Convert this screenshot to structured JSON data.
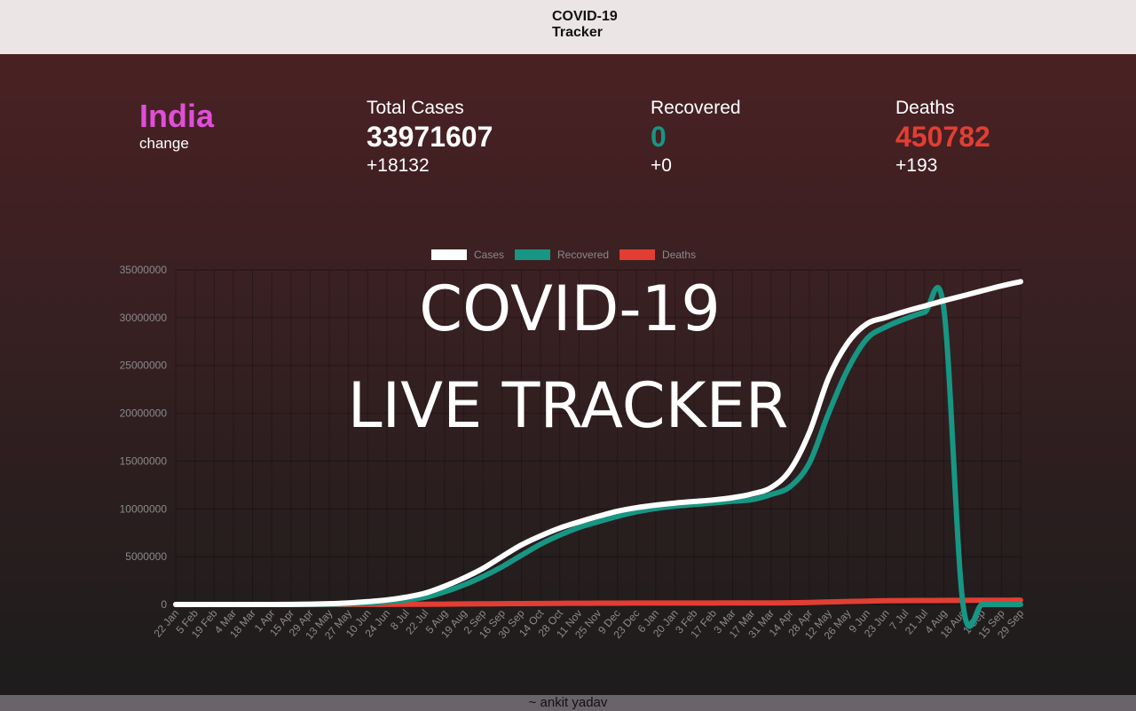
{
  "header": {
    "title_line1": "COVID-19",
    "title_line2": "Tracker"
  },
  "country": {
    "name": "India",
    "change_label": "change"
  },
  "stats": {
    "total": {
      "label": "Total Cases",
      "value": "33971607",
      "delta": "+18132",
      "color": "#ffffff"
    },
    "recovered": {
      "label": "Recovered",
      "value": "0",
      "delta": "+0",
      "color": "#179683"
    },
    "deaths": {
      "label": "Deaths",
      "value": "450782",
      "delta": "+193",
      "color": "#e23e33"
    }
  },
  "overlay": {
    "line1": "COVID-19",
    "line2": "LIVE TRACKER"
  },
  "footer": {
    "credit": "~ ankit yadav"
  },
  "chart_data": {
    "type": "line",
    "ylim": [
      0,
      35000000
    ],
    "yticks": [
      "0",
      "5000000",
      "10000000",
      "15000000",
      "20000000",
      "25000000",
      "30000000",
      "35000000"
    ],
    "categories": [
      "22 Jan",
      "5 Feb",
      "19 Feb",
      "4 Mar",
      "18 Mar",
      "1 Apr",
      "15 Apr",
      "29 Apr",
      "13 May",
      "27 May",
      "10 Jun",
      "24 Jun",
      "8 Jul",
      "22 Jul",
      "5 Aug",
      "19 Aug",
      "2 Sep",
      "16 Sep",
      "30 Sep",
      "14 Oct",
      "28 Oct",
      "11 Nov",
      "25 Nov",
      "9 Dec",
      "23 Dec",
      "6 Jan",
      "20 Jan",
      "3 Feb",
      "17 Feb",
      "3 Mar",
      "17 Mar",
      "31 Mar",
      "14 Apr",
      "28 Apr",
      "12 May",
      "26 May",
      "9 Jun",
      "23 Jun",
      "7 Jul",
      "21 Jul",
      "4 Aug",
      "18 Aug",
      "1 Sep",
      "15 Sep",
      "29 Sep"
    ],
    "legend_position": "top",
    "grid": true,
    "series": [
      {
        "name": "Cases",
        "color": "#ffffff",
        "values": [
          0,
          0,
          0,
          0,
          0,
          2000,
          12000,
          33000,
          78000,
          158000,
          298000,
          473000,
          767000,
          1193000,
          1908000,
          2768000,
          3769000,
          5020000,
          6225000,
          7175000,
          7995000,
          8637000,
          9222000,
          9755000,
          10124000,
          10395000,
          10611000,
          10777000,
          10938000,
          11174000,
          11556000,
          12221000,
          14072000,
          17997000,
          23703000,
          27369000,
          29358000,
          30028000,
          30664000,
          31216000,
          31770000,
          32286000,
          32810000,
          33317000,
          33766000
        ]
      },
      {
        "name": "Recovered",
        "color": "#179683",
        "values": [
          0,
          0,
          0,
          0,
          0,
          0,
          1500,
          9000,
          27000,
          68000,
          150000,
          285000,
          480000,
          755000,
          1320000,
          2040000,
          2925000,
          3950000,
          5140000,
          6300000,
          7250000,
          8050000,
          8650000,
          9220000,
          9700000,
          10040000,
          10280000,
          10450000,
          10620000,
          10800000,
          10960000,
          11500000,
          12330000,
          14800000,
          20000000,
          24600000,
          27800000,
          29050000,
          29890000,
          30560000,
          30950000,
          0,
          0,
          0,
          0
        ]
      },
      {
        "name": "Deaths",
        "color": "#e23e33",
        "values": [
          0,
          0,
          0,
          0,
          0,
          50,
          400,
          1100,
          2500,
          4500,
          8500,
          14500,
          21000,
          28700,
          40000,
          52900,
          66300,
          80800,
          97500,
          109900,
          120600,
          127600,
          134500,
          141400,
          146400,
          150100,
          152600,
          154700,
          156200,
          157400,
          159300,
          162700,
          173100,
          204800,
          262300,
          315300,
          353500,
          390300,
          405000,
          414400,
          425700,
          433600,
          440200,
          444900,
          447700
        ]
      }
    ]
  }
}
